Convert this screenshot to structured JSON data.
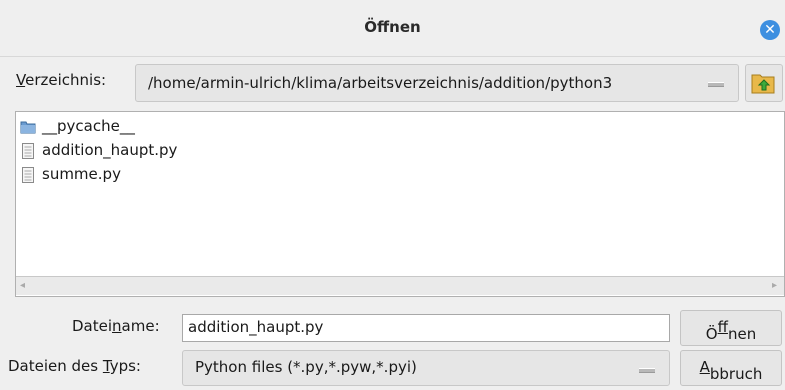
{
  "window": {
    "title": "Öffnen"
  },
  "directory": {
    "label_pre": "",
    "label_mn": "V",
    "label_post": "erzeichnis:",
    "path": "/home/armin-ulrich/klima/arbeitsverzeichnis/addition/python3"
  },
  "files": [
    {
      "name": "__pycache__",
      "type": "folder",
      "icon": "folder-icon"
    },
    {
      "name": "addition_haupt.py",
      "type": "file",
      "icon": "file-icon"
    },
    {
      "name": "summe.py",
      "type": "file",
      "icon": "file-icon"
    }
  ],
  "filename": {
    "label_pre": "Datei",
    "label_mn": "n",
    "label_post": "ame:",
    "value": "addition_haupt.py"
  },
  "filetype": {
    "label_pre": "Dateien des ",
    "label_mn": "T",
    "label_post": "yps:",
    "selected": "Python files (*.py,*.pyw,*.pyi)"
  },
  "buttons": {
    "open_pre": "Ö",
    "open_mn": "f",
    "open_post": "fnen",
    "cancel_pre": "",
    "cancel_mn": "A",
    "cancel_post": "bbruch"
  },
  "colors": {
    "accent": "#3d8fe0",
    "folder": "#5b8fc8"
  }
}
